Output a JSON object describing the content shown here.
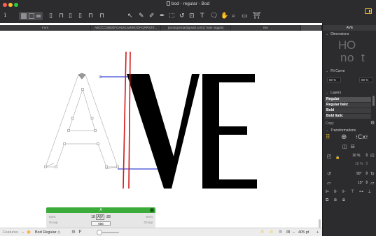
{
  "window": {
    "title": "bod - regular - Bod"
  },
  "toolbar": {
    "tools": [
      "i",
      "▯",
      "⊓",
      "▯",
      "▯",
      "⊓",
      "⊓",
      "↖",
      "✎",
      "✐",
      "✒",
      "⬚",
      "↺",
      "⊡",
      "T",
      "🗨",
      "✋",
      "⌕",
      "▭",
      "⛩"
    ]
  },
  "tabs": [
    {
      "label": "Font"
    },
    {
      "label": "ABCČĆDĐEËFGHIJKLMNŇOÖPQRŘSŠT..."
    },
    {
      "label": "(prokopzista@gmail.com) [ hate niggas]"
    },
    {
      "label": "Ete"
    },
    {
      "label": ""
    }
  ],
  "canvas": {
    "glyphs": [
      "A",
      "V",
      "E"
    ]
  },
  "kerning": {
    "pair_label": "A",
    "kern_left_label": "Kern",
    "kern_right_label": "Kern",
    "group_left_label": "Group",
    "group_right_label": "Group",
    "value_left": "18",
    "pair_text": "A|V",
    "value_right": "-28",
    "width_value": "656"
  },
  "status": {
    "features_label": "Features",
    "master_label": "Bod Regular ◇",
    "zoom_text": "405 pt",
    "zoom_minus": "−",
    "zoom_plus": "+"
  },
  "inspector": {
    "header": "AVE",
    "dimensions_label": "Dimensions",
    "preview_glyphs": [
      "H",
      "O",
      "n",
      "o",
      "t"
    ],
    "fit_curve_label": "Fit Curve",
    "fit_left": "60 %",
    "fit_right": "80 %",
    "layers_label": "Layers",
    "layers": [
      "Regular",
      "Regular Italic",
      "Bold",
      "Bold Italic"
    ],
    "copy_label": "Copy",
    "transformations_label": "Transformations",
    "scale_value": "10 %",
    "scale_value_dim": "10 %",
    "rotate_value": "90°",
    "slant_value": "15°"
  },
  "colors": {
    "accent": "#f2c230",
    "kern_green": "#3bab3a",
    "metric_blue": "#3b48d6",
    "cursor_red": "#d21717",
    "glyph_fill": "#000000"
  }
}
